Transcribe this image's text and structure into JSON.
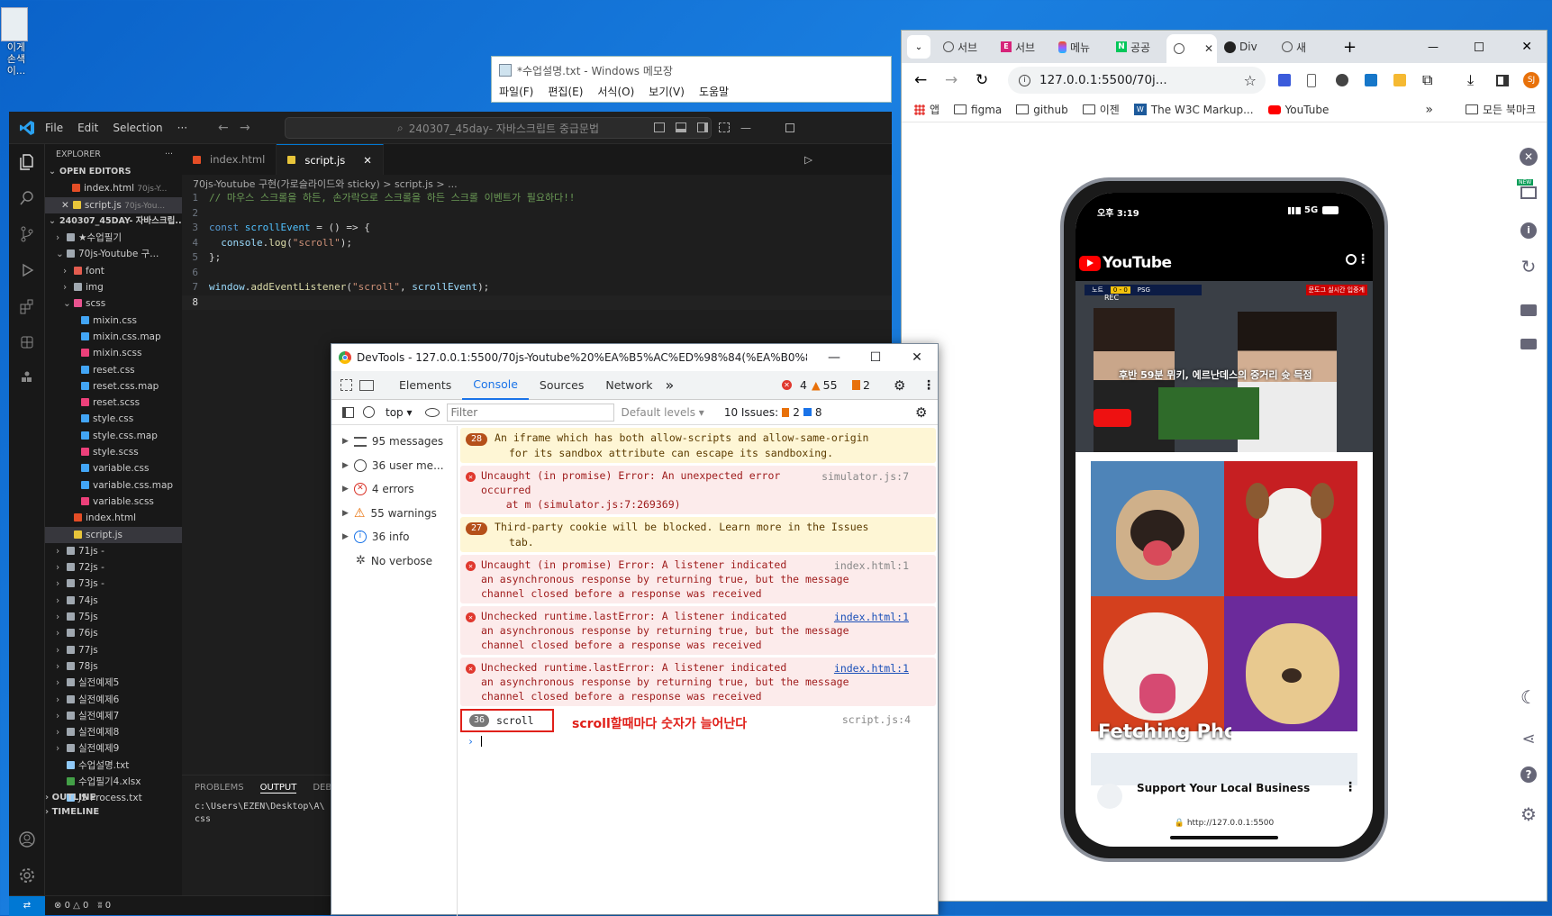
{
  "desktop": {
    "icon_label": "이게\n손색이..."
  },
  "notepad": {
    "title": "*수업설명.txt - Windows 메모장",
    "menu": [
      "파일(F)",
      "편집(E)",
      "서식(O)",
      "보기(V)",
      "도움말"
    ]
  },
  "vscode": {
    "menu": [
      "File",
      "Edit",
      "Selection",
      "···"
    ],
    "search": "240307_45day- 자바스크립트 중급문법",
    "explorer_title": "EXPLORER",
    "open_editors": "OPEN EDITORS",
    "open_files": [
      {
        "name": "index.html",
        "hint": "70js-Y...",
        "icon": "html"
      },
      {
        "name": "script.js",
        "hint": "70js-You...",
        "icon": "js"
      }
    ],
    "workspace": "240307_45DAY- 자바스크립...",
    "tree": [
      {
        "label": "★수업필기",
        "depth": 1,
        "type": "folder"
      },
      {
        "label": "70js-Youtube 구...",
        "depth": 1,
        "type": "folder-open"
      },
      {
        "label": "font",
        "depth": 2,
        "type": "folder-red"
      },
      {
        "label": "img",
        "depth": 2,
        "type": "folder"
      },
      {
        "label": "scss",
        "depth": 2,
        "type": "folder-open-pink"
      },
      {
        "label": "mixin.css",
        "depth": 3,
        "type": "css"
      },
      {
        "label": "mixin.css.map",
        "depth": 3,
        "type": "css"
      },
      {
        "label": "mixin.scss",
        "depth": 3,
        "type": "scss"
      },
      {
        "label": "reset.css",
        "depth": 3,
        "type": "css"
      },
      {
        "label": "reset.css.map",
        "depth": 3,
        "type": "css"
      },
      {
        "label": "reset.scss",
        "depth": 3,
        "type": "scss"
      },
      {
        "label": "style.css",
        "depth": 3,
        "type": "css"
      },
      {
        "label": "style.css.map",
        "depth": 3,
        "type": "css"
      },
      {
        "label": "style.scss",
        "depth": 3,
        "type": "scss"
      },
      {
        "label": "variable.css",
        "depth": 3,
        "type": "css"
      },
      {
        "label": "variable.css.map",
        "depth": 3,
        "type": "css"
      },
      {
        "label": "variable.scss",
        "depth": 3,
        "type": "scss"
      },
      {
        "label": "index.html",
        "depth": 2,
        "type": "html"
      },
      {
        "label": "script.js",
        "depth": 2,
        "type": "js",
        "selected": true
      },
      {
        "label": "71js -",
        "depth": 1,
        "type": "folder"
      },
      {
        "label": "72js -",
        "depth": 1,
        "type": "folder"
      },
      {
        "label": "73js -",
        "depth": 1,
        "type": "folder"
      },
      {
        "label": "74js",
        "depth": 1,
        "type": "folder"
      },
      {
        "label": "75js",
        "depth": 1,
        "type": "folder"
      },
      {
        "label": "76js",
        "depth": 1,
        "type": "folder"
      },
      {
        "label": "77js",
        "depth": 1,
        "type": "folder"
      },
      {
        "label": "78js",
        "depth": 1,
        "type": "folder"
      },
      {
        "label": "실전예제5",
        "depth": 1,
        "type": "folder"
      },
      {
        "label": "실전예제6",
        "depth": 1,
        "type": "folder"
      },
      {
        "label": "실전예제7",
        "depth": 1,
        "type": "folder"
      },
      {
        "label": "실전예제8",
        "depth": 1,
        "type": "folder"
      },
      {
        "label": "실전예제9",
        "depth": 1,
        "type": "folder"
      },
      {
        "label": "수업설명.txt",
        "depth": 1,
        "type": "txt"
      },
      {
        "label": "수업필기4.xlsx",
        "depth": 1,
        "type": "xlsx"
      },
      {
        "label": "JS Process.txt",
        "depth": 1,
        "type": "txt"
      }
    ],
    "tabs": [
      {
        "name": "index.html",
        "active": false
      },
      {
        "name": "script.js",
        "active": true
      }
    ],
    "breadcrumb": "70js-Youtube 구현(가로슬라이드와 sticky) > script.js > ...",
    "outline": "OUTLINE",
    "timeline": "TIMELINE",
    "panel_tabs": [
      "PROBLEMS",
      "OUTPUT",
      "DEBUG C"
    ],
    "panel_lines": [
      "c:\\Users\\EZEN\\Desktop\\A\\",
      "css"
    ],
    "status": {
      "problems": "0",
      "warnings": "0",
      "ports": "0"
    }
  },
  "devtools": {
    "title": "DevTools - 127.0.0.1:5500/70js-Youtube%20%EA%B5%AC%ED%98%84(%EA%B0%80%EB%A...",
    "tabs": [
      "Elements",
      "Console",
      "Sources",
      "Network"
    ],
    "badges": {
      "errors": "4",
      "warnings": "55",
      "issues": "2"
    },
    "context": "top",
    "filter_placeholder": "Filter",
    "levels": "Default levels",
    "issues_label": "10 Issues:",
    "issues_warn": "2",
    "issues_info": "8",
    "sidebar": [
      {
        "icon": "list-icon",
        "label": "95 messages"
      },
      {
        "icon": "user-icon",
        "label": "36 user me..."
      },
      {
        "icon": "error-icon",
        "label": "4 errors"
      },
      {
        "icon": "warning-icon",
        "label": "55 warnings"
      },
      {
        "icon": "info-icon",
        "label": "36 info"
      },
      {
        "icon": "verbose-icon",
        "label": "No verbose"
      }
    ],
    "messages": [
      {
        "level": "warn",
        "count": "28",
        "lines": [
          "An iframe which has both allow-scripts and allow-same-origin",
          "for its sandbox attribute can escape its sandboxing."
        ],
        "source": ""
      },
      {
        "level": "err",
        "count": "",
        "lines": [
          "Uncaught (in promise) Error: An unexpected error",
          "occurred",
          "    at m (simulator.js:7:269369)"
        ],
        "source": "simulator.js:7",
        "link": false
      },
      {
        "level": "warn",
        "count": "27",
        "lines": [
          "Third-party cookie will be blocked. Learn more in the Issues",
          "tab."
        ],
        "source": ""
      },
      {
        "level": "err",
        "count": "",
        "lines": [
          "Uncaught (in promise) Error: A listener indicated",
          "an asynchronous response by returning true, but the message",
          "channel closed before a response was received"
        ],
        "source": "index.html:1",
        "link": false
      },
      {
        "level": "err",
        "count": "",
        "lines": [
          "Unchecked runtime.lastError: A listener indicated",
          "an asynchronous response by returning true, but the message",
          "channel closed before a response was received"
        ],
        "source": "index.html:1",
        "link": true
      },
      {
        "level": "err",
        "count": "",
        "lines": [
          "Unchecked runtime.lastError: A listener indicated",
          "an asynchronous response by returning true, but the message",
          "channel closed before a response was received"
        ],
        "source": "index.html:1",
        "link": true
      }
    ],
    "scroll_count": "36",
    "scroll_text": "scroll",
    "scroll_source": "script.js:4",
    "annotation": "scroll할때마다 숫자가 늘어난다"
  },
  "chrome": {
    "tabs": [
      "서브",
      "서브",
      "메뉴",
      "공공",
      "",
      "Div",
      "새"
    ],
    "url": "127.0.0.1:5500/70j...",
    "profile": "SJ",
    "bookmarks": [
      "앱",
      "figma",
      "github",
      "이젠",
      "The W3C Markup...",
      "YouTube"
    ],
    "all_bookmarks": "모든 북마크"
  },
  "phone": {
    "time": "오후 3:19",
    "signal": "5G",
    "yt_logo": "YouTube",
    "video_caption": "후반 59분 뮈키, 에르난데스의 중거리 슛 득점",
    "live_tag": "문도그 실시간 입중계",
    "score_home": "노트",
    "score": "0 - 0",
    "score_away": "PSG",
    "rec": "REC",
    "fetching": "Fetching Photo",
    "ad_title": "Support Your Local Business",
    "url": "http://127.0.0.1:5500"
  },
  "colors": {
    "vscode_bg": "#1e1e1e",
    "devtools_accent": "#1a73e8",
    "error": "#e0382e",
    "annotation": "#e0201a",
    "youtube_red": "#ff0000"
  }
}
